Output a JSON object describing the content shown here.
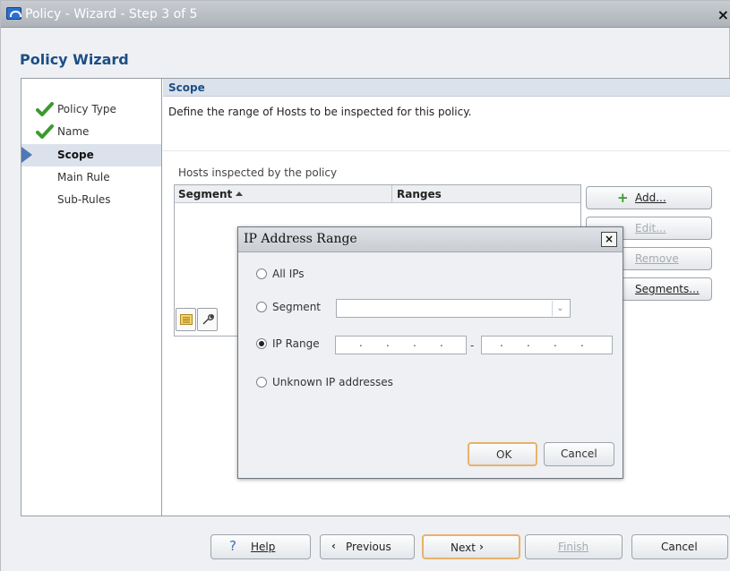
{
  "window": {
    "title": "Policy - Wizard - Step 3 of 5",
    "close_glyph": "×"
  },
  "wizard": {
    "heading": "Policy Wizard"
  },
  "steps": [
    {
      "label": "Policy Type",
      "state": "done",
      "icon": "check-icon"
    },
    {
      "label": "Name",
      "state": "done",
      "icon": "check-icon"
    },
    {
      "label": "Scope",
      "state": "current",
      "icon": "arrow-right-icon"
    },
    {
      "label": "Main Rule",
      "state": "pending"
    },
    {
      "label": "Sub-Rules",
      "state": "pending"
    }
  ],
  "scope": {
    "header": "Scope",
    "description": "Define the range of Hosts to be inspected for this policy.",
    "hosts_label": "Hosts inspected by the policy",
    "columns": [
      "Segment",
      "Ranges"
    ]
  },
  "side_buttons": {
    "add": "Add...",
    "edit": "Edit...",
    "remove": "Remove",
    "segments": "Segments..."
  },
  "footer": {
    "help": "Help",
    "previous": "Previous",
    "next": "Next",
    "finish": "Finish",
    "cancel": "Cancel"
  },
  "dialog": {
    "title": "IP Address Range",
    "close_glyph": "×",
    "options": {
      "all_ips": "All IPs",
      "segment": "Segment",
      "ip_range": "IP Range",
      "unknown": "Unknown IP addresses"
    },
    "selected_option": "IP Range",
    "range_separator": "-",
    "ok": "OK",
    "cancel": "Cancel"
  },
  "colors": {
    "accent": "#1c4e86",
    "check": "#3a9a2e",
    "step_highlight": "#dce2ec",
    "primary_border": "#e7b26a"
  }
}
